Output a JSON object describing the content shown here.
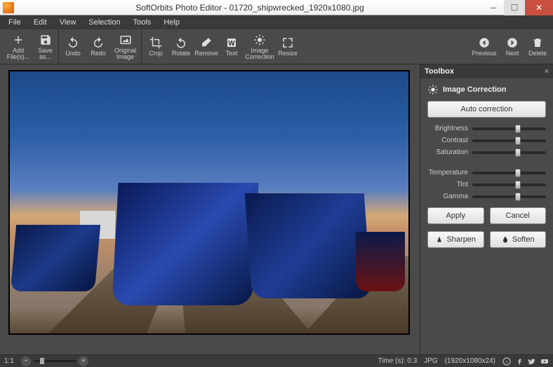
{
  "title": "SoftOrbits Photo Editor - 01720_shipwrecked_1920x1080.jpg",
  "menus": {
    "file": "File",
    "edit": "Edit",
    "view": "View",
    "selection": "Selection",
    "tools": "Tools",
    "help": "Help"
  },
  "tools": {
    "addfiles": "Add\nFile(s)...",
    "saveas": "Save\nas...",
    "undo": "Undo",
    "redo": "Redo",
    "original": "Original\nImage",
    "crop": "Crop",
    "rotate": "Rotate",
    "remove": "Remove",
    "text": "Text",
    "correction": "Image\nCorrection",
    "resize": "Resize",
    "previous": "Previous",
    "next": "Next",
    "delete": "Delete"
  },
  "toolbox": {
    "title": "Toolbox",
    "section": "Image Correction",
    "auto": "Auto correction",
    "sliders": {
      "brightness": "Brightness",
      "contrast": "Contrast",
      "saturation": "Saturation",
      "temperature": "Temperature",
      "tint": "Tint",
      "gamma": "Gamma"
    },
    "apply": "Apply",
    "cancel": "Cancel",
    "sharpen": "Sharpen",
    "soften": "Soften"
  },
  "status": {
    "ratio": "1:1",
    "minus": "−",
    "plus": "+",
    "time": "Time (s): 0.3",
    "format": "JPG",
    "dims": "(1920x1080x24)"
  }
}
